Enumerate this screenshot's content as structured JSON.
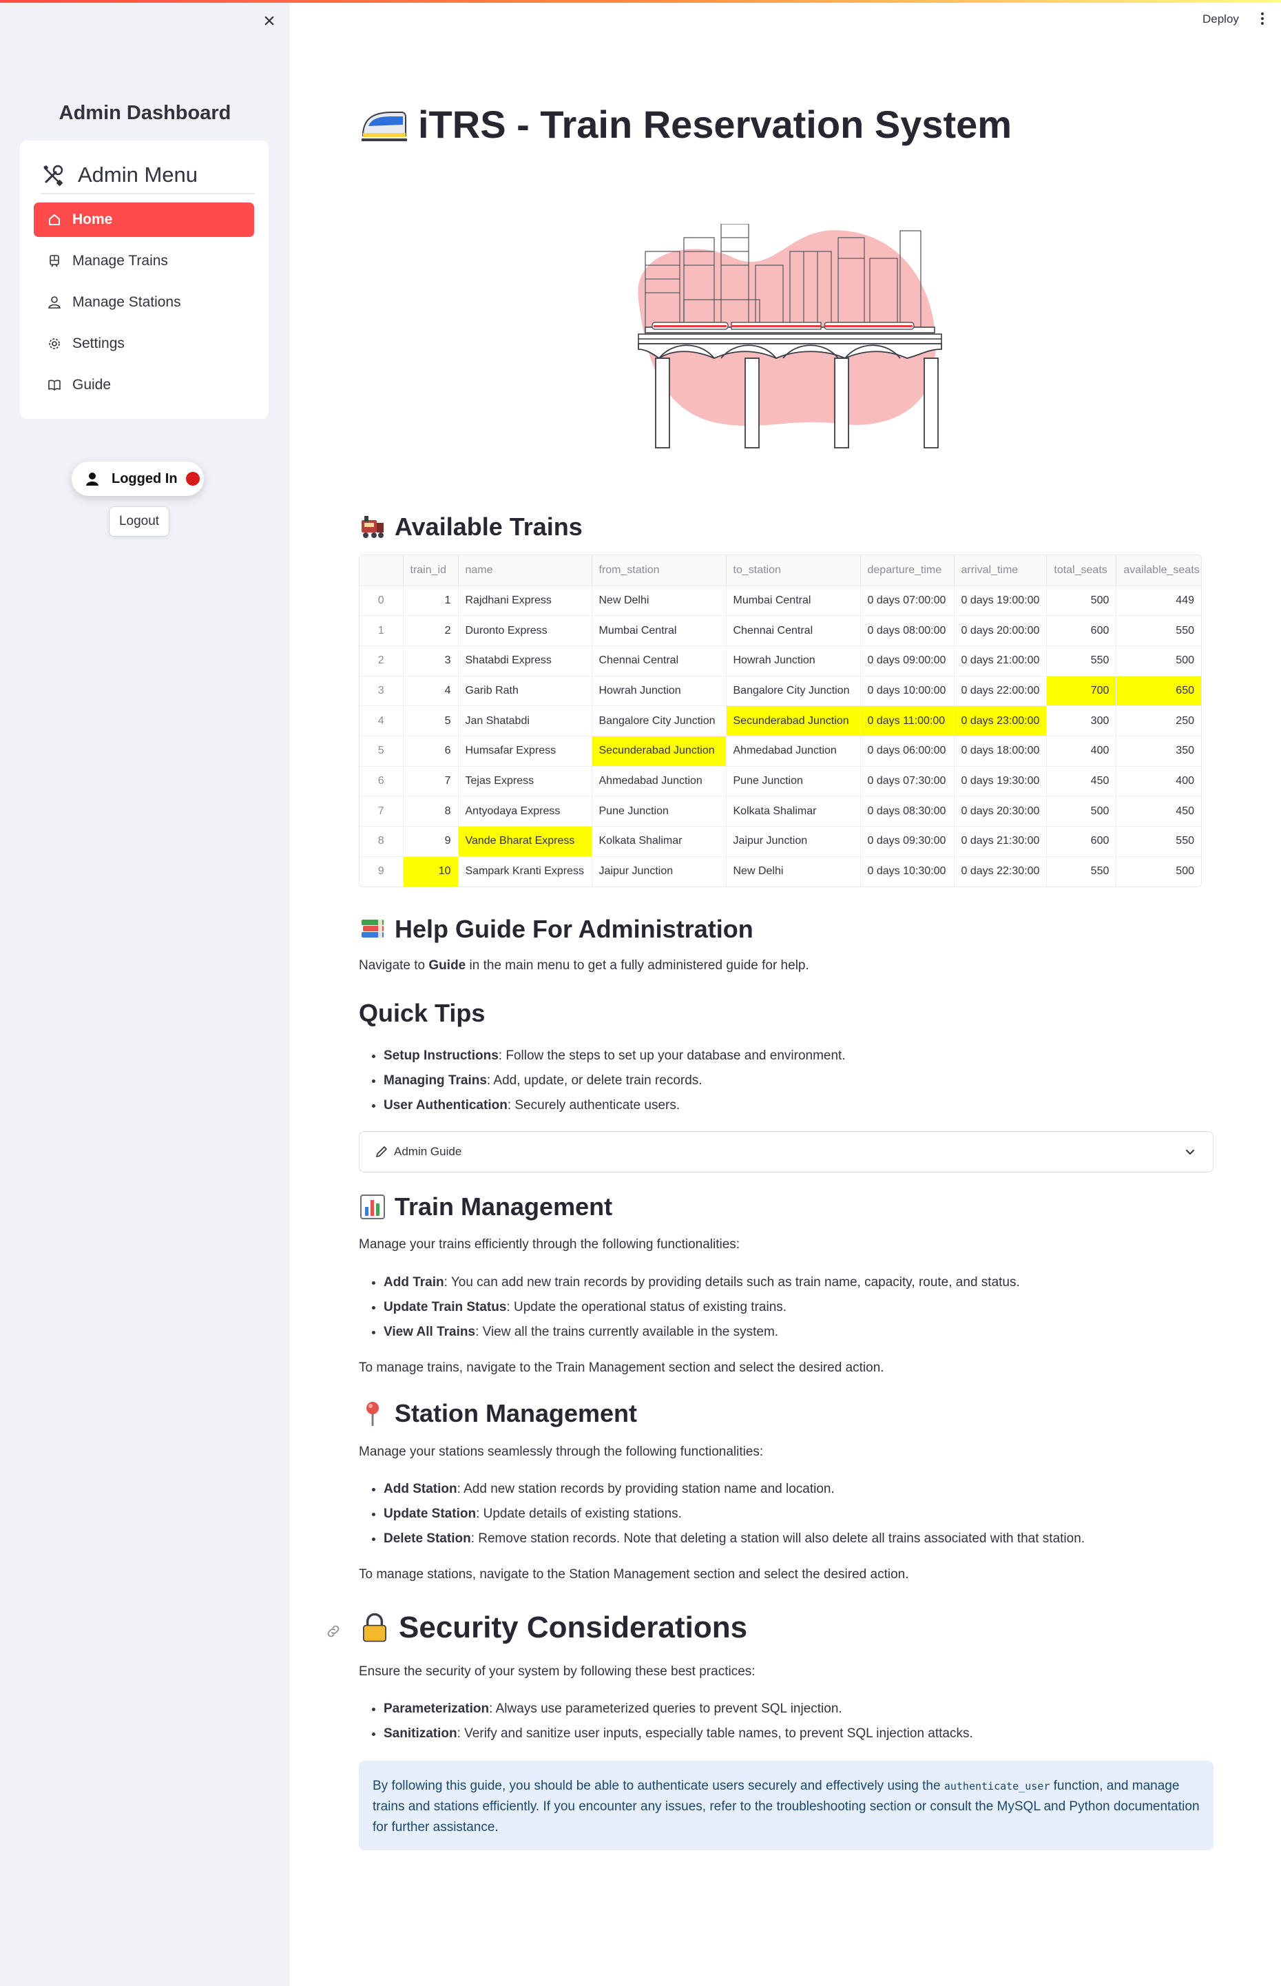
{
  "sidebar": {
    "title": "Admin Dashboard",
    "menu_title": "Admin Menu",
    "items": [
      {
        "label": "Home",
        "icon": "home-icon",
        "active": true
      },
      {
        "label": "Manage Trains",
        "icon": "train-icon"
      },
      {
        "label": "Manage Stations",
        "icon": "person-icon"
      },
      {
        "label": "Settings",
        "icon": "gear-icon"
      },
      {
        "label": "Guide",
        "icon": "book-icon"
      }
    ],
    "status_label": "Logged In",
    "logout_label": "Logout"
  },
  "header": {
    "deploy_label": "Deploy"
  },
  "main": {
    "title": "iTRS - Train Reservation System",
    "trains_heading": "Available Trains",
    "table": {
      "columns": [
        "",
        "train_id",
        "name",
        "from_station",
        "to_station",
        "departure_time",
        "arrival_time",
        "total_seats",
        "available_seats"
      ],
      "rows": [
        [
          "0",
          "1",
          "Rajdhani Express",
          "New Delhi",
          "Mumbai Central",
          "0 days 07:00:00",
          "0 days 19:00:00",
          "500",
          "449"
        ],
        [
          "1",
          "2",
          "Duronto Express",
          "Mumbai Central",
          "Chennai Central",
          "0 days 08:00:00",
          "0 days 20:00:00",
          "600",
          "550"
        ],
        [
          "2",
          "3",
          "Shatabdi Express",
          "Chennai Central",
          "Howrah Junction",
          "0 days 09:00:00",
          "0 days 21:00:00",
          "550",
          "500"
        ],
        [
          "3",
          "4",
          "Garib Rath",
          "Howrah Junction",
          "Bangalore City Junction",
          "0 days 10:00:00",
          "0 days 22:00:00",
          "700",
          "650"
        ],
        [
          "4",
          "5",
          "Jan Shatabdi",
          "Bangalore City Junction",
          "Secunderabad Junction",
          "0 days 11:00:00",
          "0 days 23:00:00",
          "300",
          "250"
        ],
        [
          "5",
          "6",
          "Humsafar Express",
          "Secunderabad Junction",
          "Ahmedabad Junction",
          "0 days 06:00:00",
          "0 days 18:00:00",
          "400",
          "350"
        ],
        [
          "6",
          "7",
          "Tejas Express",
          "Ahmedabad Junction",
          "Pune Junction",
          "0 days 07:30:00",
          "0 days 19:30:00",
          "450",
          "400"
        ],
        [
          "7",
          "8",
          "Antyodaya Express",
          "Pune Junction",
          "Kolkata Shalimar",
          "0 days 08:30:00",
          "0 days 20:30:00",
          "500",
          "450"
        ],
        [
          "8",
          "9",
          "Vande Bharat Express",
          "Kolkata Shalimar",
          "Jaipur Junction",
          "0 days 09:30:00",
          "0 days 21:30:00",
          "600",
          "550"
        ],
        [
          "9",
          "10",
          "Sampark Kranti Express",
          "Jaipur Junction",
          "New Delhi",
          "0 days 10:30:00",
          "0 days 22:30:00",
          "550",
          "500"
        ]
      ],
      "highlighted_cells": [
        [
          3,
          7
        ],
        [
          3,
          8
        ],
        [
          4,
          4
        ],
        [
          4,
          5
        ],
        [
          4,
          6
        ],
        [
          5,
          3
        ],
        [
          8,
          2
        ],
        [
          9,
          1
        ]
      ],
      "highlight_color": "#ffff00"
    },
    "help_heading": "Help Guide For Administration",
    "help_text_pre": "Navigate to ",
    "help_text_bold": "Guide",
    "help_text_post": " in the main menu to get a fully administered guide for help.",
    "quick_tips_heading": "Quick Tips",
    "quick_tips": [
      {
        "bold": "Setup Instructions",
        "text": ": Follow the steps to set up your database and environment."
      },
      {
        "bold": "Managing Trains",
        "text": ": Add, update, or delete train records."
      },
      {
        "bold": "User Authentication",
        "text": ": Securely authenticate users."
      }
    ],
    "expander_label": "Admin Guide",
    "train_mgmt_heading": "Train Management",
    "train_mgmt_intro": "Manage your trains efficiently through the following functionalities:",
    "train_mgmt_items": [
      {
        "bold": "Add Train",
        "text": ": You can add new train records by providing details such as train name, capacity, route, and status."
      },
      {
        "bold": "Update Train Status",
        "text": ": Update the operational status of existing trains."
      },
      {
        "bold": "View All Trains",
        "text": ": View all the trains currently available in the system."
      }
    ],
    "train_mgmt_footer": "To manage trains, navigate to the Train Management section and select the desired action.",
    "station_mgmt_heading": "Station Management",
    "station_mgmt_intro": "Manage your stations seamlessly through the following functionalities:",
    "station_mgmt_items": [
      {
        "bold": "Add Station",
        "text": ": Add new station records by providing station name and location."
      },
      {
        "bold": "Update Station",
        "text": ": Update details of existing stations."
      },
      {
        "bold": "Delete Station",
        "text": ": Remove station records. Note that deleting a station will also delete all trains associated with that station."
      }
    ],
    "station_mgmt_footer": "To manage stations, navigate to the Station Management section and select the desired action.",
    "security_heading": "Security Considerations",
    "security_intro": "Ensure the security of your system by following these best practices:",
    "security_items": [
      {
        "bold": "Parameterization",
        "text": ": Always use parameterized queries to prevent SQL injection."
      },
      {
        "bold": "Sanitization",
        "text": ": Verify and sanitize user inputs, especially table names, to prevent SQL injection attacks."
      }
    ],
    "info_pre": "By following this guide, you should be able to authenticate users securely and effectively using the ",
    "info_code": "authenticate_user",
    "info_post": " function, and manage trains and stations efficiently. If you encounter any issues, refer to the troubleshooting section or consult the MySQL and Python documentation for further assistance."
  }
}
